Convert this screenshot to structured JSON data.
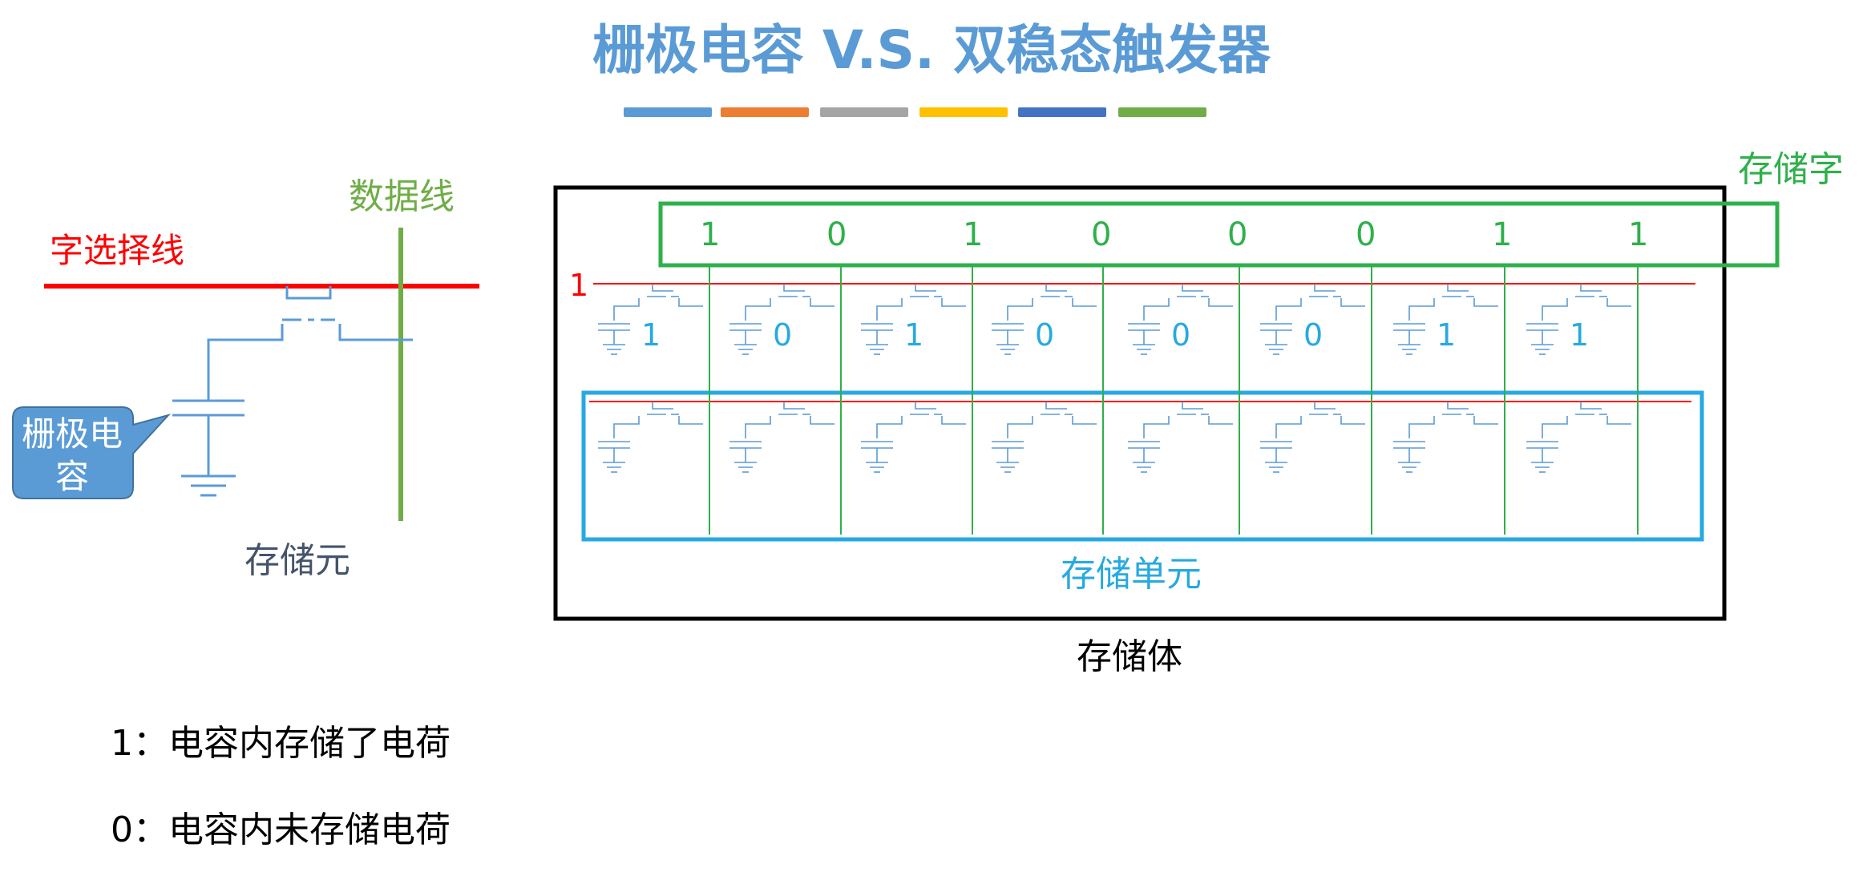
{
  "title": "栅极电容 V.S. 双稳态触发器",
  "title_bar_colors": [
    "#5b9bd5",
    "#ed7d31",
    "#a5a5a5",
    "#ffc000",
    "#4472c4",
    "#70ad47"
  ],
  "left_cell": {
    "word_line_label": "字选择线",
    "data_line_label": "数据线",
    "capacitor_callout": "栅极电容",
    "cell_label": "存储元"
  },
  "memory_body": {
    "body_label": "存储体",
    "word_label": "存储字",
    "unit_label": "存储单元",
    "selected_row_value": "1",
    "word_bits": [
      "1",
      "0",
      "1",
      "0",
      "0",
      "0",
      "1",
      "1"
    ],
    "cell_bits": [
      "1",
      "0",
      "1",
      "0",
      "0",
      "0",
      "1",
      "1"
    ],
    "colors": {
      "frame": "#000000",
      "word_box": "#2eb04a",
      "unit_box": "#27a9e1",
      "word_line": "#ff0000",
      "bit_line": "#2eb04a",
      "circuit": "#5b9bd5"
    }
  },
  "legend": {
    "one": "1：电容内存储了电荷",
    "zero": "0：电容内未存储电荷"
  }
}
